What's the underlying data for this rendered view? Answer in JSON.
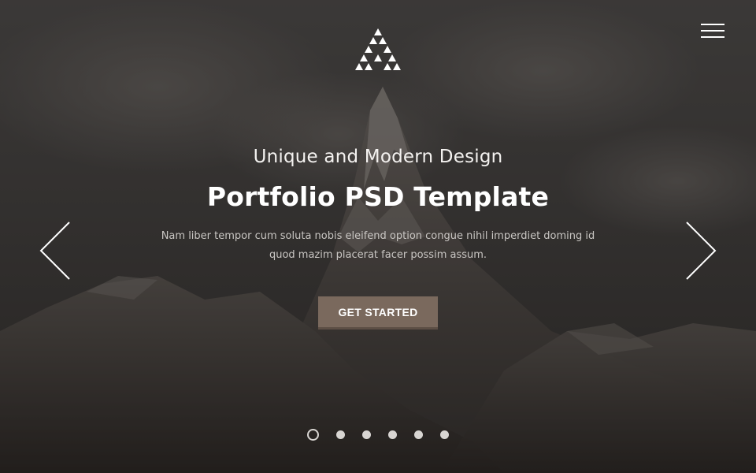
{
  "hero": {
    "subtitle": "Unique and Modern Design",
    "title": "Portfolio PSD Template",
    "description_line1": "Nam liber tempor cum soluta nobis eleifend option congue nihil imperdiet doming id",
    "description_line2": "quod mazim placerat facer possim assum.",
    "cta_label": "GET STARTED"
  },
  "header": {
    "logo_icon": "triangle-logo-icon",
    "menu_icon": "hamburger-menu-icon"
  },
  "slider": {
    "prev_icon": "chevron-left-icon",
    "next_icon": "chevron-right-icon",
    "total_slides": 6,
    "active_slide": 1
  },
  "colors": {
    "accent_button": "#7a695d",
    "overlay": "#1f1d1c"
  }
}
